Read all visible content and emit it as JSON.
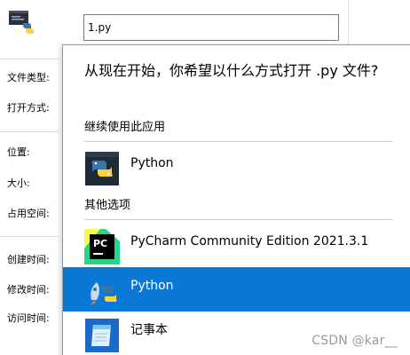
{
  "properties": {
    "filename_value": "1.py",
    "labels": {
      "file_type": "文件类型:",
      "open_with": "打开方式:",
      "location": "位置:",
      "size": "大小:",
      "size_on_disk": "占用空间:",
      "created": "创建时间:",
      "modified": "修改时间:",
      "accessed": "访问时间:"
    }
  },
  "flyout": {
    "title": "从现在开始，你希望以什么方式打开 .py 文件?",
    "keep_using_heading": "继续使用此应用",
    "other_options_heading": "其他选项",
    "apps": [
      {
        "label": "Python",
        "icon": "python-icon",
        "selected": false
      },
      {
        "label": "PyCharm Community Edition 2021.3.1",
        "icon": "pycharm-icon",
        "selected": false
      },
      {
        "label": "Python",
        "icon": "python-launcher-icon",
        "selected": true
      },
      {
        "label": "记事本",
        "icon": "notepad-icon",
        "selected": false
      }
    ]
  },
  "colors": {
    "selection": "#0a78d7",
    "python_blue": "#3b74a8",
    "python_yellow": "#ffd242"
  },
  "watermark": "CSDN @kar__"
}
